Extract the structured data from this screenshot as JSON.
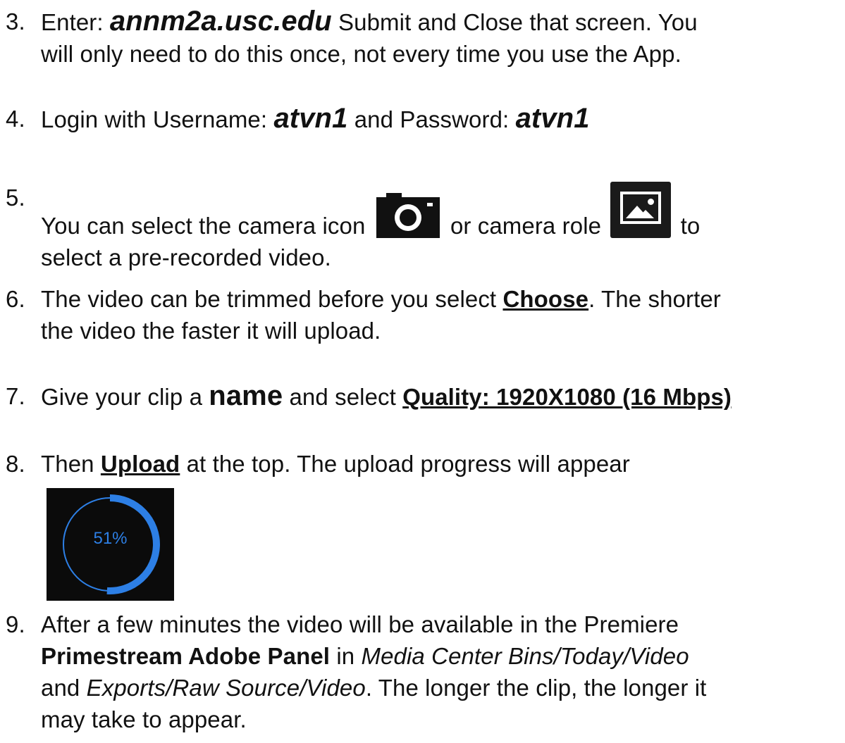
{
  "steps": [
    {
      "num": "3.",
      "a": "Enter: ",
      "host": "annm2a.usc.edu",
      "b": " Submit and Close that screen.  You",
      "c": "will only need to do this once, not every time you use the App."
    },
    {
      "num": "4.",
      "a": "Login with Username: ",
      "user": "atvn1",
      "b": " and Password: ",
      "pass": "atvn1"
    },
    {
      "num": "5.",
      "a": "You can select the camera icon ",
      "b": " or camera role ",
      "c": " to",
      "d": "select a pre-recorded video.",
      "icon1": "camera-icon",
      "icon2": "photo-library-icon"
    },
    {
      "num": "6.",
      "a": "The video can be trimmed before you select ",
      "choose": "Choose",
      "b": ".  The shorter",
      "c": "the video the faster it will upload."
    },
    {
      "num": "7.",
      "a": "Give your clip a ",
      "name": "name",
      "b": " and select ",
      "quality": "Quality: 1920X1080 (16 Mbps)"
    },
    {
      "num": "8.",
      "a": "Then ",
      "upload": "Upload",
      "b": " at the top.  The upload progress will appear"
    },
    {
      "num": "9.",
      "a": "After a few minutes the video will be available in the Premiere",
      "panel": "Primestream Adobe Panel",
      "b": " in ",
      "path1": "Media Center Bins/Today/Video",
      "c": "and ",
      "path2": "Exports/Raw Source/Video",
      "d": ".  The longer the clip, the longer it",
      "e": "may take to appear."
    }
  ],
  "progress": {
    "label": "51%",
    "value": 0.51,
    "color": "#2d7fe5"
  }
}
